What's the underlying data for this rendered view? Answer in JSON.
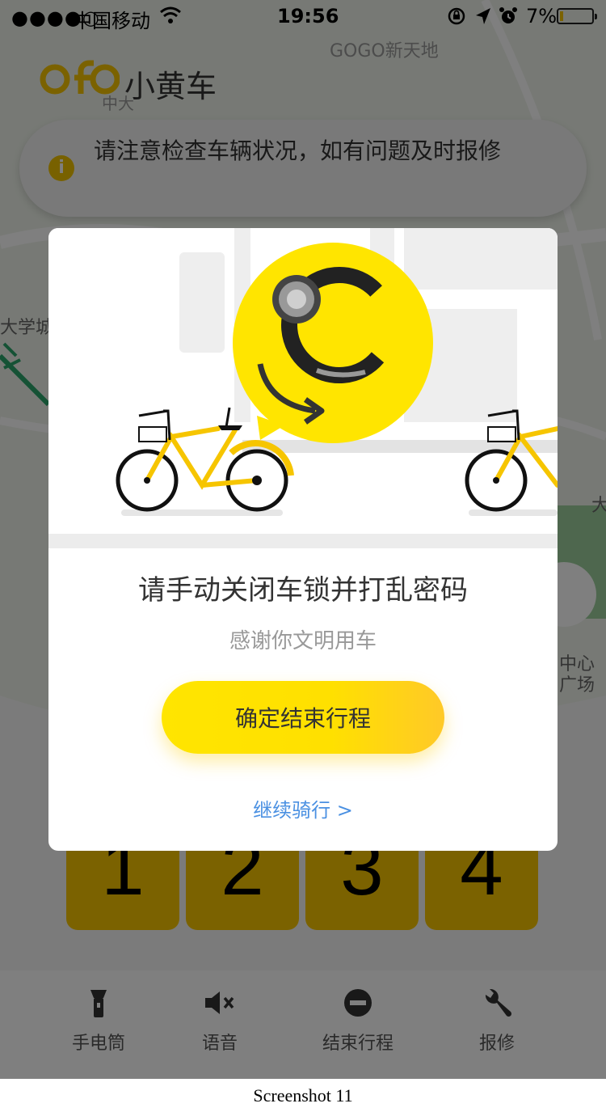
{
  "status_bar": {
    "signal": "●●●●○",
    "carrier": "中国移动",
    "time": "19:56",
    "battery": "7%"
  },
  "header": {
    "logo_letters": "ofo",
    "brand": "小黄车"
  },
  "map_labels": {
    "gogo": "GOGO新天地",
    "zhongda": "中大",
    "daxuecheng": "大学城",
    "center_line1": "中心",
    "center_line2": "广场",
    "da": "大"
  },
  "notice": {
    "icon": "info-icon",
    "message": "请注意检查车辆状况，如有问题及时报修"
  },
  "keypad": {
    "digits": [
      "1",
      "2",
      "3",
      "4"
    ]
  },
  "toolbar": {
    "items": [
      {
        "label": "手电筒",
        "icon": "flashlight-icon"
      },
      {
        "label": "语音",
        "icon": "mute-icon"
      },
      {
        "label": "结束行程",
        "icon": "minus-circle-icon"
      },
      {
        "label": "报修",
        "icon": "wrench-icon"
      }
    ]
  },
  "modal": {
    "title": "请手动关闭车锁并打乱密码",
    "subtitle": "感谢你文明用车",
    "confirm_label": "确定结束行程",
    "continue_label": "继续骑行 >"
  },
  "caption": "Screenshot 11",
  "colors": {
    "brand_yellow": "#ffe000",
    "link_blue": "#4a90e2",
    "overlay": "rgba(0,0,0,0.5)"
  }
}
